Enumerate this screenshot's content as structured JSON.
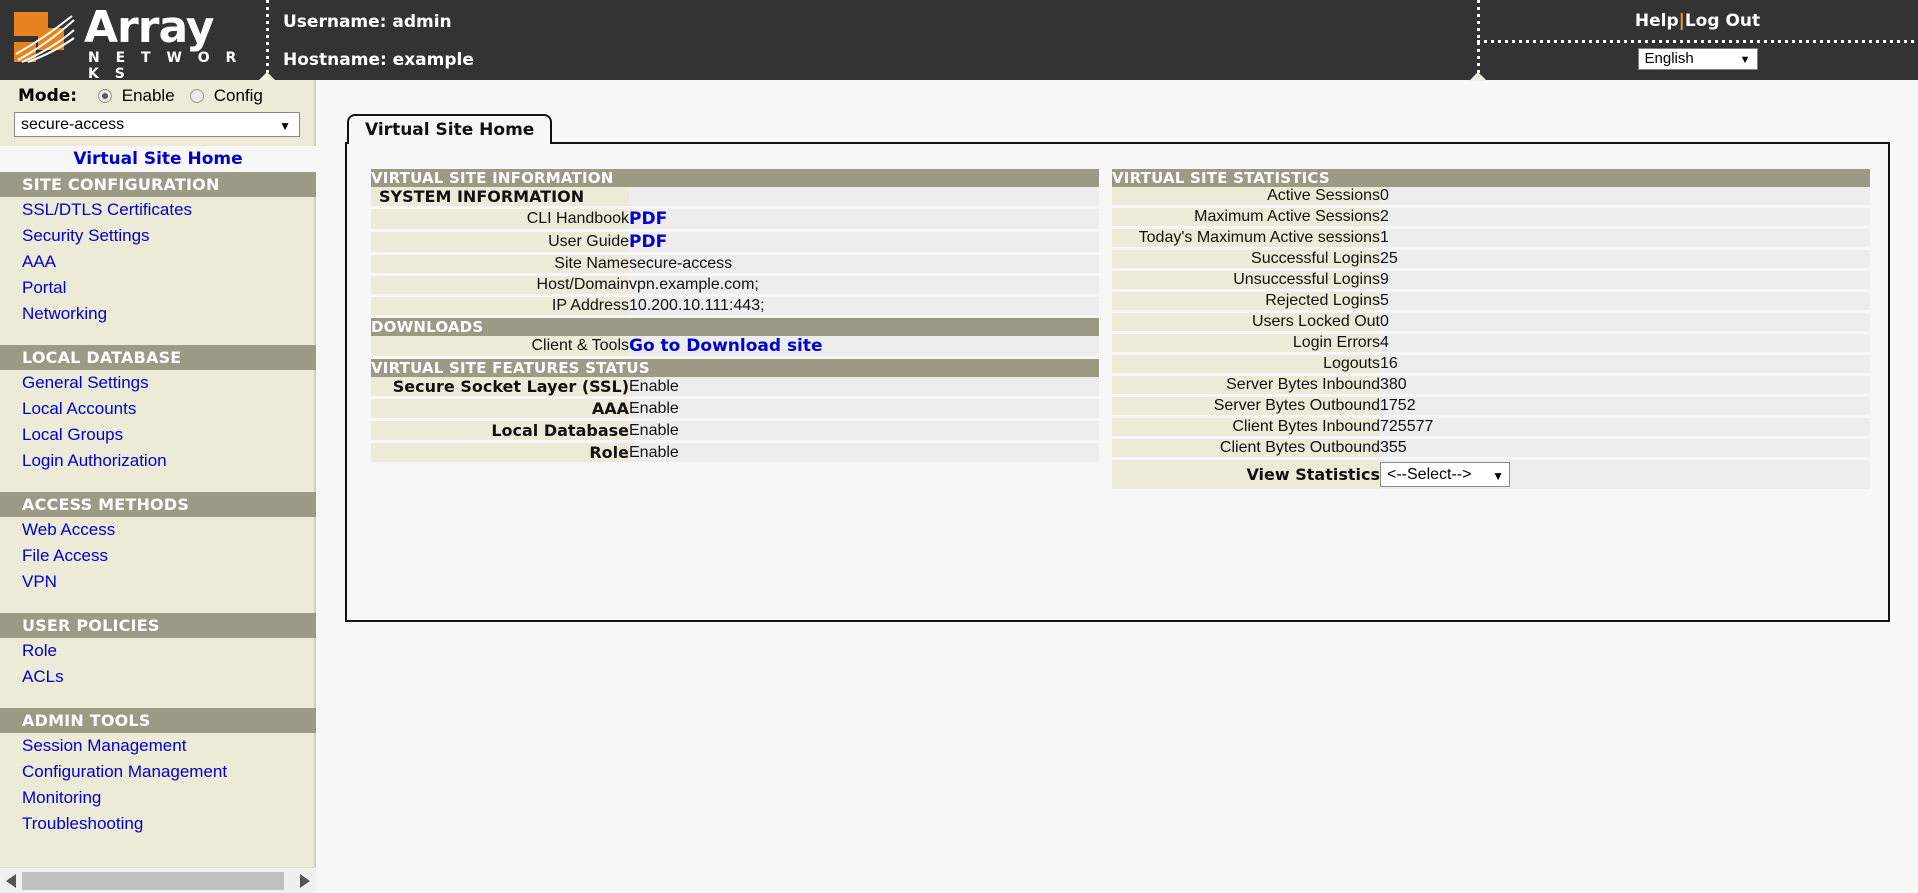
{
  "header": {
    "brand_name": "Array",
    "brand_sub": "N E T W O R K S",
    "username_line": "Username: admin",
    "hostname_line": "Hostname: example",
    "help_label": "Help",
    "separator": "|",
    "logout_label": "Log Out",
    "language_value": "English"
  },
  "sidebar": {
    "mode_label": "Mode:",
    "mode_enable": "Enable",
    "mode_config": "Config",
    "site_selected": "secure-access",
    "home_link": "Virtual Site Home",
    "sections": [
      {
        "title": "SITE CONFIGURATION",
        "items": [
          "SSL/DTLS Certificates",
          "Security Settings",
          "AAA",
          "Portal",
          "Networking"
        ]
      },
      {
        "title": "LOCAL DATABASE",
        "items": [
          "General Settings",
          "Local Accounts",
          "Local Groups",
          "Login Authorization"
        ]
      },
      {
        "title": "ACCESS METHODS",
        "items": [
          "Web Access",
          "File Access",
          "VPN"
        ]
      },
      {
        "title": "USER POLICIES",
        "items": [
          "Role",
          "ACLs"
        ]
      },
      {
        "title": "ADMIN TOOLS",
        "items": [
          "Session Management",
          "Configuration Management",
          "Monitoring",
          "Troubleshooting"
        ]
      }
    ]
  },
  "main": {
    "tab_label": "Virtual Site Home",
    "left": {
      "section_info": "VIRTUAL SITE INFORMATION",
      "subsection_system": "SYSTEM INFORMATION",
      "rows_system": [
        {
          "label": "CLI Handbook",
          "value": "PDF",
          "is_link": true
        },
        {
          "label": "User Guide",
          "value": "PDF",
          "is_link": true
        },
        {
          "label": "Site Name",
          "value": "secure-access",
          "is_link": false
        },
        {
          "label": "Host/Domain",
          "value": "vpn.example.com;",
          "is_link": false
        },
        {
          "label": "IP Address",
          "value": "10.200.10.111:443;",
          "is_link": false
        }
      ],
      "section_downloads": "DOWNLOADS",
      "rows_downloads": [
        {
          "label": "Client & Tools",
          "value": "Go to Download site",
          "is_link": true
        }
      ],
      "section_features": "VIRTUAL SITE FEATURES STATUS",
      "rows_features": [
        {
          "label": "Secure Socket Layer (SSL)",
          "value": "Enable"
        },
        {
          "label": "AAA",
          "value": "Enable"
        },
        {
          "label": "Local Database",
          "value": "Enable"
        },
        {
          "label": "Role",
          "value": "Enable"
        }
      ]
    },
    "right": {
      "section_stats": "VIRTUAL SITE STATISTICS",
      "rows_stats": [
        {
          "label": "Active Sessions",
          "value": "0"
        },
        {
          "label": "Maximum Active Sessions",
          "value": "2"
        },
        {
          "label": "Today's Maximum Active sessions",
          "value": "1"
        },
        {
          "label": "Successful Logins",
          "value": "25"
        },
        {
          "label": "Unsuccessful Logins",
          "value": "9"
        },
        {
          "label": "Rejected Logins",
          "value": "5"
        },
        {
          "label": "Users Locked Out",
          "value": "0"
        },
        {
          "label": "Login Errors",
          "value": "4"
        },
        {
          "label": "Logouts",
          "value": "16"
        },
        {
          "label": "Server Bytes Inbound",
          "value": "380"
        },
        {
          "label": "Server Bytes Outbound",
          "value": "1752"
        },
        {
          "label": "Client Bytes Inbound",
          "value": "725577"
        },
        {
          "label": "Client Bytes Outbound",
          "value": "355"
        }
      ],
      "view_stats_label": "View Statistics",
      "view_stats_value": "<--Select-->"
    }
  },
  "icons": {
    "chevron_down": "▼",
    "scroll_left": "scroll-left-arrow",
    "scroll_right": "scroll-right-arrow"
  },
  "colors": {
    "header_bg": "#333333",
    "sidebar_bg": "#ebebd7",
    "section_bar": "#9a9a85",
    "link": "#0000cc",
    "row_value_bg": "#ededed",
    "brand_orange": "#e8821e"
  }
}
